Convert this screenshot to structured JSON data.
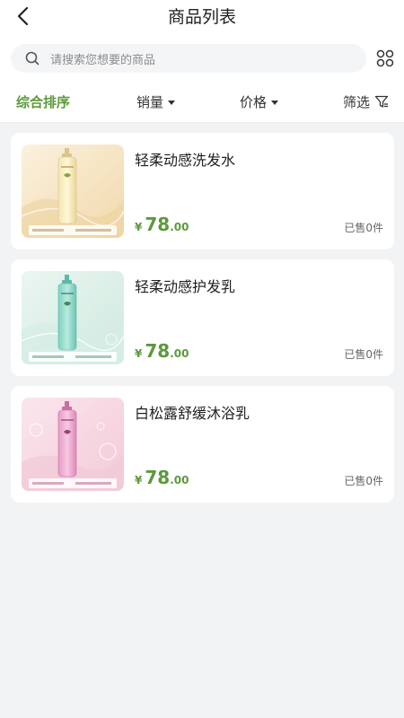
{
  "header": {
    "title": "商品列表",
    "back_icon": "chevron-left-icon"
  },
  "search": {
    "placeholder": "请搜索您想要的商品",
    "icon": "search-icon",
    "grid_icon": "grid-icon"
  },
  "sort": {
    "comprehensive": "综合排序",
    "sales": "销量",
    "price": "价格",
    "filter": "筛选",
    "active_color": "#5b9a3a"
  },
  "products": [
    {
      "name": "轻柔动感洗发水",
      "currency": "¥",
      "price_int": "78",
      "price_dec": ".00",
      "sold": "已售0件",
      "theme": "gold"
    },
    {
      "name": "轻柔动感护发乳",
      "currency": "¥",
      "price_int": "78",
      "price_dec": ".00",
      "sold": "已售0件",
      "theme": "mint"
    },
    {
      "name": "白松露舒缓沐浴乳",
      "currency": "¥",
      "price_int": "78",
      "price_dec": ".00",
      "sold": "已售0件",
      "theme": "pink"
    }
  ]
}
